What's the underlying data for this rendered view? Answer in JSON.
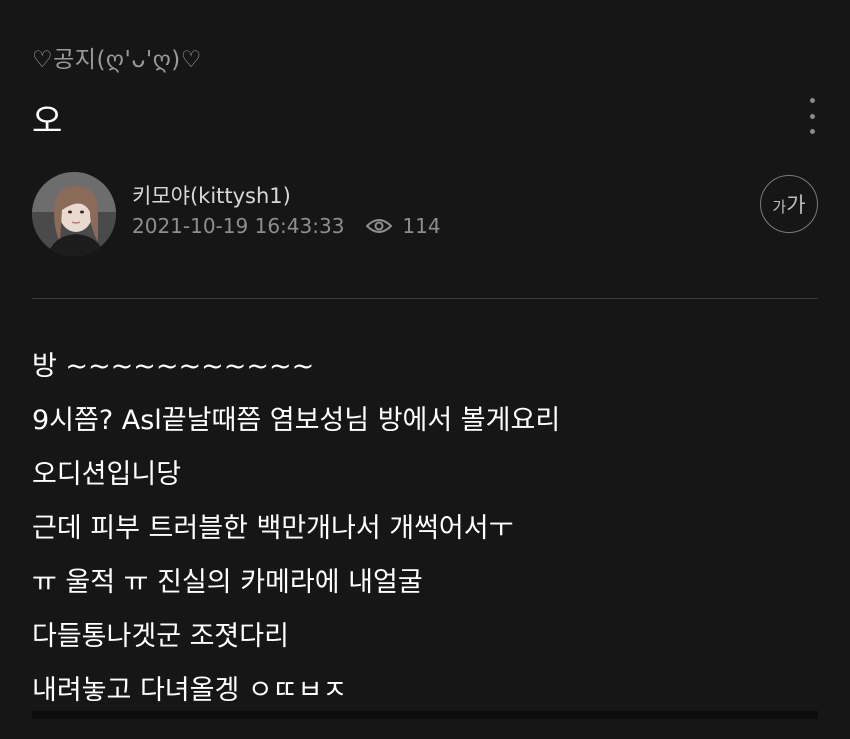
{
  "post": {
    "category": "♡공지(ღ'ᴗ'ღ)♡",
    "title": "오",
    "author": {
      "name": "키모야(kittysh1)",
      "datetime": "2021-10-19 16:43:33",
      "views": "114"
    },
    "font_size_button": {
      "small": "가",
      "big": "가"
    },
    "body_lines": [
      "방 ~~~~~~~~~~~",
      "9시쯤? Asl끝날때쯤 염보성님 방에서 볼게요리",
      "오디션입니당",
      "근데 피부 트러블한 백만개나서 개썩어서ㅜ",
      "ㅠ 울적 ㅠ 진실의 카메라에 내얼굴",
      "다들통나겟군 조졋다리",
      "내려놓고 다녀올겡 ㅇㄸㅂㅈ"
    ]
  },
  "icons": {
    "more": "more-vertical-icon",
    "views": "eye-icon"
  },
  "colors": {
    "background": "#161616",
    "text_primary": "#ffffff",
    "text_muted": "#8e8e8e"
  }
}
